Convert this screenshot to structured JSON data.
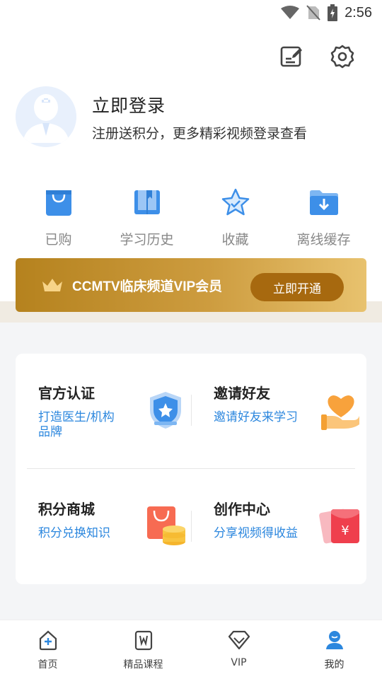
{
  "status_bar": {
    "time": "2:56"
  },
  "profile": {
    "title": "立即登录",
    "subtitle": "注册送积分，更多精彩视频登录查看"
  },
  "quick_entries": [
    {
      "label": "已购",
      "icon": "shopping-bag-icon"
    },
    {
      "label": "学习历史",
      "icon": "book-icon"
    },
    {
      "label": "收藏",
      "icon": "star-icon"
    },
    {
      "label": "离线缓存",
      "icon": "download-folder-icon"
    }
  ],
  "vip": {
    "text": "CCMTV临床频道VIP会员",
    "button": "立即开通"
  },
  "services": [
    {
      "title": "官方认证",
      "subtitle": "打造医生/机构品牌",
      "icon": "shield-star-icon"
    },
    {
      "title": "邀请好友",
      "subtitle": "邀请好友来学习",
      "icon": "heart-hand-icon"
    },
    {
      "title": "积分商城",
      "subtitle": "积分兑换知识",
      "icon": "shopping-coins-icon"
    },
    {
      "title": "创作中心",
      "subtitle": "分享视频得收益",
      "icon": "red-envelope-icon"
    }
  ],
  "bottom_nav": [
    {
      "label": "首页",
      "icon": "home-icon"
    },
    {
      "label": "精品课程",
      "icon": "course-icon"
    },
    {
      "label": "VIP",
      "icon": "diamond-icon"
    },
    {
      "label": "我的",
      "icon": "user-icon",
      "active": true
    }
  ],
  "colors": {
    "accent_blue": "#2c87de",
    "vip_gold": "#c9963a",
    "vip_button": "#a7690f"
  }
}
